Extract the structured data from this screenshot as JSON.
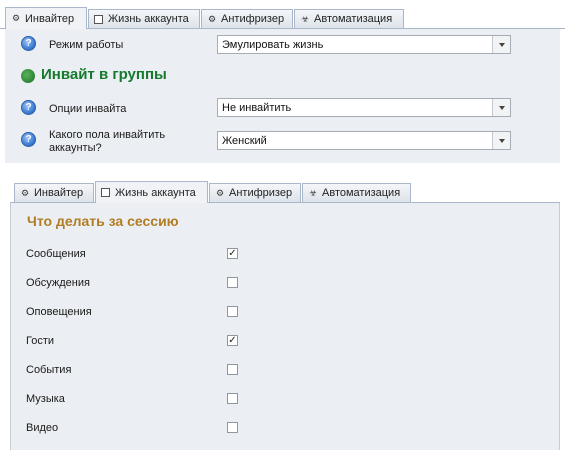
{
  "outer_tabs": [
    {
      "label": "Инвайтер",
      "icon": "gear-icon",
      "active": true
    },
    {
      "label": "Жизнь аккаунта",
      "icon": "checkbox-icon",
      "active": false
    },
    {
      "label": "Антифризер",
      "icon": "gear-icon",
      "active": false
    },
    {
      "label": "Автоматизация",
      "icon": "biohazard-icon",
      "active": false
    }
  ],
  "settings": {
    "mode_label": "Режим работы",
    "mode_value": "Эмулировать жизнь",
    "section_title": "Инвайт в группы",
    "invite_options_label": "Опции инвайта",
    "invite_options_value": "Не инвайтить",
    "gender_label_line1": "Какого пола инвайтить",
    "gender_label_line2": "аккаунты?",
    "gender_value": "Женский",
    "help_glyph": "?"
  },
  "inner_tabs": [
    {
      "label": "Инвайтер",
      "icon": "gear-icon",
      "active": false
    },
    {
      "label": "Жизнь аккаунта",
      "icon": "checkbox-icon",
      "active": true
    },
    {
      "label": "Антифризер",
      "icon": "gear-icon",
      "active": false
    },
    {
      "label": "Автоматизация",
      "icon": "biohazard-icon",
      "active": false
    }
  ],
  "session": {
    "title": "Что делать за сессию",
    "items": [
      {
        "label": "Сообщения",
        "checked": true
      },
      {
        "label": "Обсуждения",
        "checked": false
      },
      {
        "label": "Оповещения",
        "checked": false
      },
      {
        "label": "Гости",
        "checked": true
      },
      {
        "label": "События",
        "checked": false
      },
      {
        "label": "Музыка",
        "checked": false
      },
      {
        "label": "Видео",
        "checked": false
      }
    ]
  },
  "colors": {
    "section_title": "#167a2d",
    "session_title": "#b17d24",
    "panel_bg": "#ebeef2"
  }
}
